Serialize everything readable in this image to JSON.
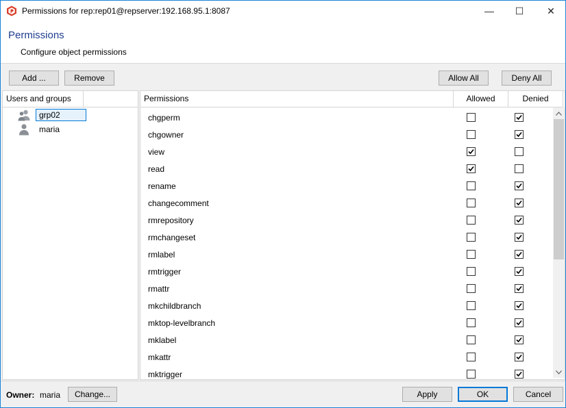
{
  "window": {
    "title": "Permissions for rep:rep01@repserver:192.168.95.1:8087",
    "minimize_glyph": "—",
    "maximize_glyph": "☐",
    "close_glyph": "✕"
  },
  "header": {
    "title": "Permissions",
    "subtitle": "Configure object permissions"
  },
  "toolbar": {
    "add_label": "Add ...",
    "remove_label": "Remove",
    "allow_all_label": "Allow All",
    "deny_all_label": "Deny All"
  },
  "users_panel": {
    "header": "Users and groups",
    "items": [
      {
        "label": "grp02",
        "icon": "group-icon",
        "selected": true
      },
      {
        "label": "maria",
        "icon": "user-icon",
        "selected": false
      }
    ]
  },
  "permissions_panel": {
    "headers": {
      "name": "Permissions",
      "allowed": "Allowed",
      "denied": "Denied"
    },
    "rows": [
      {
        "name": "chgperm",
        "allowed": false,
        "denied": true
      },
      {
        "name": "chgowner",
        "allowed": false,
        "denied": true
      },
      {
        "name": "view",
        "allowed": true,
        "denied": false
      },
      {
        "name": "read",
        "allowed": true,
        "denied": false
      },
      {
        "name": "rename",
        "allowed": false,
        "denied": true
      },
      {
        "name": "changecomment",
        "allowed": false,
        "denied": true
      },
      {
        "name": "rmrepository",
        "allowed": false,
        "denied": true
      },
      {
        "name": "rmchangeset",
        "allowed": false,
        "denied": true
      },
      {
        "name": "rmlabel",
        "allowed": false,
        "denied": true
      },
      {
        "name": "rmtrigger",
        "allowed": false,
        "denied": true
      },
      {
        "name": "rmattr",
        "allowed": false,
        "denied": true
      },
      {
        "name": "mkchildbranch",
        "allowed": false,
        "denied": true
      },
      {
        "name": "mktop-levelbranch",
        "allowed": false,
        "denied": true
      },
      {
        "name": "mklabel",
        "allowed": false,
        "denied": true
      },
      {
        "name": "mkattr",
        "allowed": false,
        "denied": true
      },
      {
        "name": "mktrigger",
        "allowed": false,
        "denied": true
      }
    ]
  },
  "footer": {
    "owner_label": "Owner:",
    "owner_value": "maria",
    "change_label": "Change...",
    "apply_label": "Apply",
    "ok_label": "OK",
    "cancel_label": "Cancel"
  },
  "colors": {
    "accent": "#0078d7",
    "header_title": "#1e3d8f",
    "app_icon": "#d9412b"
  }
}
